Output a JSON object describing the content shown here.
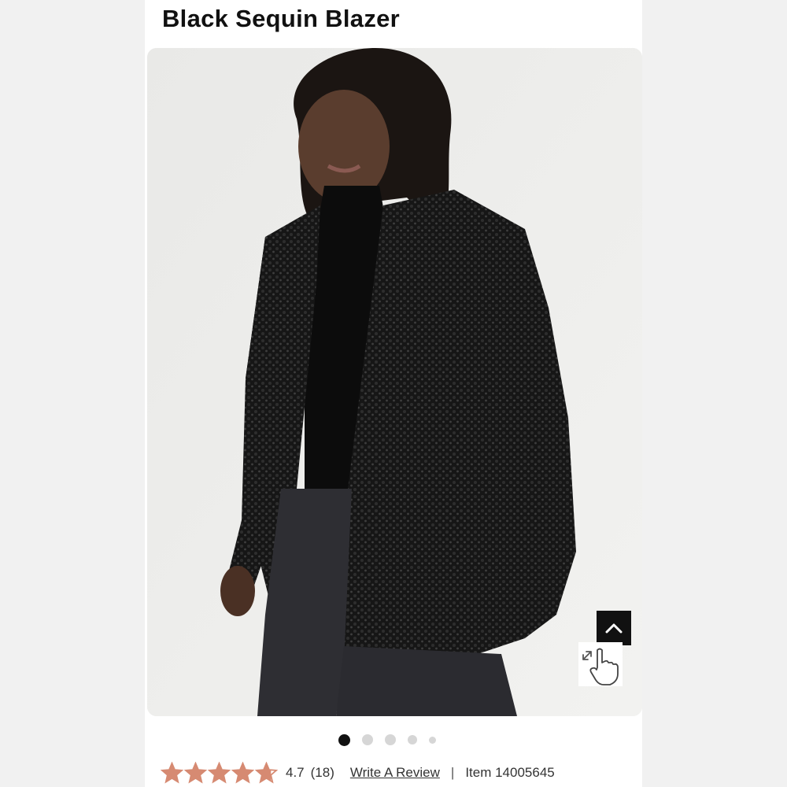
{
  "product": {
    "title": "Black Sequin Blazer"
  },
  "gallery": {
    "dot_count": 5,
    "active_index": 0
  },
  "rating": {
    "value": "4.7",
    "stars": 4.7,
    "count": "(18)",
    "write_review_label": "Write A Review",
    "divider": "|",
    "item_label": "Item 14005645",
    "star_color": "#d68a72"
  },
  "icons": {
    "scroll_top": "chevron-up-icon",
    "zoom": "expand-hand-icon"
  }
}
